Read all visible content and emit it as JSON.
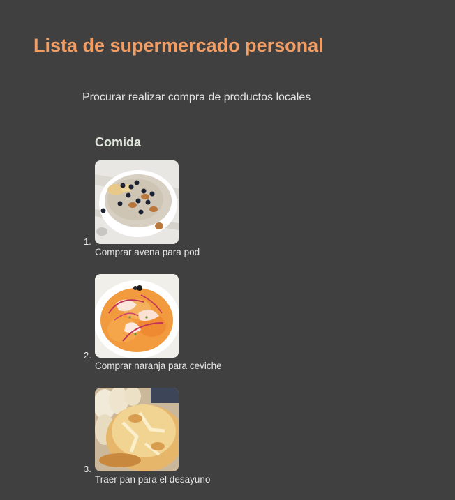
{
  "page": {
    "title": "Lista de supermercado personal",
    "subtitle": "Procurar realizar compra de productos locales"
  },
  "section": {
    "title": "Comida",
    "items": [
      {
        "number": "1.",
        "image": "oatmeal-bowl-image",
        "caption": "Comprar avena para pod"
      },
      {
        "number": "2.",
        "image": "orange-ceviche-image",
        "caption": "Comprar naranja para ceviche"
      },
      {
        "number": "3.",
        "image": "bread-loaf-image",
        "caption": "Traer pan para el desayuno"
      }
    ]
  },
  "colors": {
    "background": "#404040",
    "title": "#f29d64",
    "text": "#e6e6e6"
  }
}
